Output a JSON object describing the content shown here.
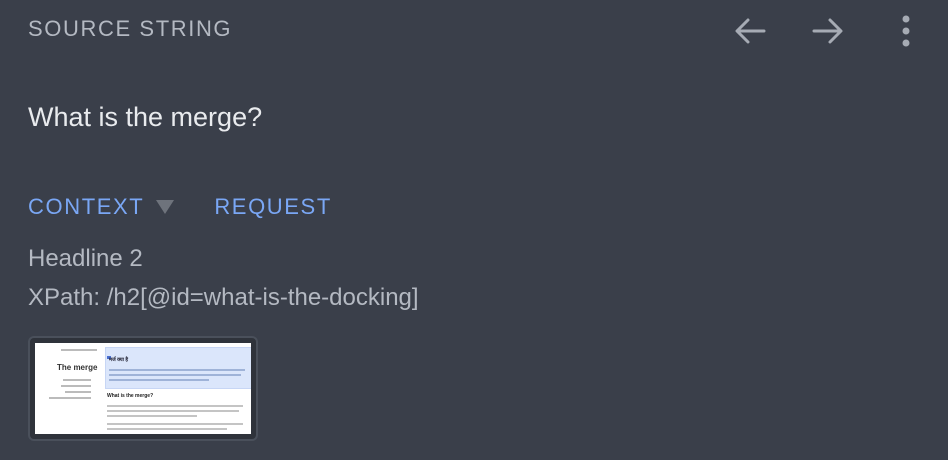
{
  "header": {
    "section_label": "SOURCE STRING",
    "icons": {
      "prev": "arrow-left-icon",
      "next": "arrow-right-icon",
      "more": "more-vertical-icon"
    }
  },
  "source": {
    "text": "What is the merge?"
  },
  "tabs": {
    "context_label": "CONTEXT",
    "request_label": "REQUEST"
  },
  "context": {
    "line1": "Headline 2",
    "line2": "XPath: /h2[@id=what-is-the-docking]"
  },
  "screenshot_preview": {
    "page_title": "The merge",
    "panel_title": "मर्ज क्या है",
    "body_title": "What is the merge?"
  },
  "colors": {
    "background": "#3a3f4a",
    "muted_text": "#b4b9c2",
    "accent": "#7aa7f5"
  }
}
